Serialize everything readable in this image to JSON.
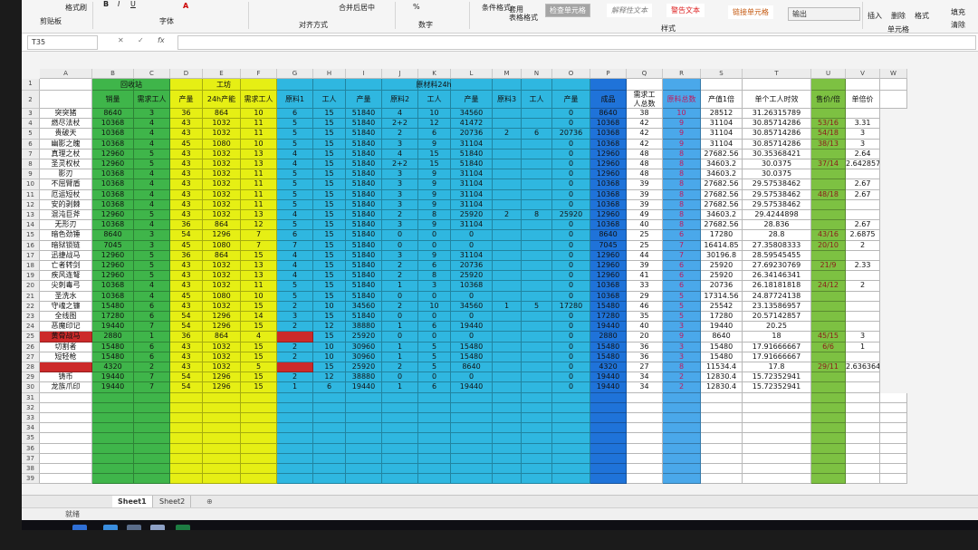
{
  "ribbon": {
    "format_painter": "格式刷",
    "clipboard": "剪贴板",
    "font_group": "字体",
    "align_group": "对齐方式",
    "merge_center": "合并后居中",
    "number_group": "数字",
    "percent": "%",
    "cond_format": "条件格式",
    "table_format": "套用\n表格格式",
    "styles_group": "样式",
    "style_check": "检查单元格",
    "style_explain": "解释性文本",
    "style_warn": "警告文本",
    "style_link": "链接单元格",
    "style_output": "输出",
    "insert": "插入",
    "delete": "删除",
    "format": "格式",
    "cells_group": "单元格",
    "fill": "填充",
    "clear": "清除",
    "bold": "B",
    "italic": "I",
    "underline": "U"
  },
  "formula_bar": {
    "name_box": "T35",
    "cancel": "✕",
    "confirm": "✓",
    "fx": "fx"
  },
  "columns": [
    "A",
    "B",
    "C",
    "D",
    "E",
    "F",
    "G",
    "H",
    "I",
    "J",
    "K",
    "L",
    "M",
    "N",
    "O",
    "P",
    "Q",
    "R",
    "S",
    "T",
    "U",
    "V",
    "W"
  ],
  "header_row1": {
    "A": "",
    "B": "回收站",
    "E": "工坊",
    "G": "原材料24h"
  },
  "header_row2": [
    "",
    "销量",
    "需求工人",
    "产量",
    "24h产能",
    "需求工人",
    "原料1",
    "工人",
    "产量",
    "原料2",
    "工人",
    "产量",
    "原料3",
    "工人",
    "产量",
    "成品",
    "需求工\n人总数",
    "原料总数",
    "产值1倍",
    "单个工人时效",
    "售价/倍",
    "单倍价",
    ""
  ],
  "rows": [
    [
      "突突猪",
      "8640",
      "3",
      "36",
      "864",
      "10",
      "6",
      "15",
      "51840",
      "4",
      "10",
      "34560",
      "",
      "",
      "0",
      "8640",
      "38",
      "10",
      "28512",
      "31.26315789",
      "",
      ""
    ],
    [
      "燃尽法杖",
      "10368",
      "4",
      "43",
      "1032",
      "11",
      "5",
      "15",
      "51840",
      "2+2",
      "12",
      "41472",
      "",
      "",
      "0",
      "10368",
      "42",
      "9",
      "31104",
      "30.85714286",
      "53/16",
      "3.31"
    ],
    [
      "贵破天",
      "10368",
      "4",
      "43",
      "1032",
      "11",
      "5",
      "15",
      "51840",
      "2",
      "6",
      "20736",
      "2",
      "6",
      "20736",
      "10368",
      "42",
      "9",
      "31104",
      "30.85714286",
      "54/18",
      "3"
    ],
    [
      "幽影之魄",
      "10368",
      "4",
      "45",
      "1080",
      "10",
      "5",
      "15",
      "51840",
      "3",
      "9",
      "31104",
      "",
      "",
      "0",
      "10368",
      "42",
      "9",
      "31104",
      "30.85714286",
      "38/13",
      "3"
    ],
    [
      "真理之杖",
      "12960",
      "5",
      "43",
      "1032",
      "13",
      "4",
      "15",
      "51840",
      "4",
      "15",
      "51840",
      "",
      "",
      "0",
      "12960",
      "48",
      "8",
      "27682.56",
      "30.35368421",
      "",
      "2.64"
    ],
    [
      "圣灵权杖",
      "12960",
      "5",
      "43",
      "1032",
      "13",
      "4",
      "15",
      "51840",
      "2+2",
      "15",
      "51840",
      "",
      "",
      "0",
      "12960",
      "48",
      "8",
      "34603.2",
      "30.0375",
      "37/14",
      "2.642857"
    ],
    [
      "影刃",
      "10368",
      "4",
      "43",
      "1032",
      "11",
      "5",
      "15",
      "51840",
      "3",
      "9",
      "31104",
      "",
      "",
      "0",
      "12960",
      "48",
      "8",
      "34603.2",
      "30.0375",
      "",
      ""
    ],
    [
      "不屈臂盾",
      "10368",
      "4",
      "43",
      "1032",
      "11",
      "5",
      "15",
      "51840",
      "3",
      "9",
      "31104",
      "",
      "",
      "0",
      "10368",
      "39",
      "8",
      "27682.56",
      "29.57538462",
      "",
      "2.67"
    ],
    [
      "厄运短杖",
      "10368",
      "4",
      "43",
      "1032",
      "11",
      "5",
      "15",
      "51840",
      "3",
      "9",
      "31104",
      "",
      "",
      "0",
      "10368",
      "39",
      "8",
      "27682.56",
      "29.57538462",
      "48/18",
      "2.67"
    ],
    [
      "安的剥棘",
      "10368",
      "4",
      "43",
      "1032",
      "11",
      "5",
      "15",
      "51840",
      "3",
      "9",
      "31104",
      "",
      "",
      "0",
      "10368",
      "39",
      "8",
      "27682.56",
      "29.57538462",
      "",
      ""
    ],
    [
      "混沌巨斧",
      "12960",
      "5",
      "43",
      "1032",
      "13",
      "4",
      "15",
      "51840",
      "2",
      "8",
      "25920",
      "2",
      "8",
      "25920",
      "12960",
      "49",
      "8",
      "34603.2",
      "29.4244898",
      "",
      ""
    ],
    [
      "无形刃",
      "10368",
      "4",
      "36",
      "864",
      "12",
      "5",
      "15",
      "51840",
      "3",
      "9",
      "31104",
      "",
      "",
      "0",
      "10368",
      "40",
      "8",
      "27682.56",
      "28.836",
      "",
      "2.67"
    ],
    [
      "暗色劲锤",
      "8640",
      "3",
      "54",
      "1296",
      "7",
      "6",
      "15",
      "51840",
      "0",
      "0",
      "0",
      "",
      "",
      "0",
      "8640",
      "25",
      "6",
      "17280",
      "28.8",
      "43/16",
      "2.6875"
    ],
    [
      "暗狱锁链",
      "7045",
      "3",
      "45",
      "1080",
      "7",
      "7",
      "15",
      "51840",
      "0",
      "0",
      "0",
      "",
      "",
      "0",
      "7045",
      "25",
      "7",
      "16414.85",
      "27.35808333",
      "20/10",
      "2"
    ],
    [
      "迅捷战马",
      "12960",
      "5",
      "36",
      "864",
      "15",
      "4",
      "15",
      "51840",
      "3",
      "9",
      "31104",
      "",
      "",
      "0",
      "12960",
      "44",
      "7",
      "30196.8",
      "28.59545455",
      "",
      ""
    ],
    [
      "亡者转剑",
      "12960",
      "5",
      "43",
      "1032",
      "13",
      "4",
      "15",
      "51840",
      "2",
      "6",
      "20736",
      "",
      "",
      "0",
      "12960",
      "39",
      "6",
      "25920",
      "27.69230769",
      "21/9",
      "2.33"
    ],
    [
      "疾风连弩",
      "12960",
      "5",
      "43",
      "1032",
      "13",
      "4",
      "15",
      "51840",
      "2",
      "8",
      "25920",
      "",
      "",
      "0",
      "12960",
      "41",
      "6",
      "25920",
      "26.34146341",
      "",
      ""
    ],
    [
      "尖刺毒弓",
      "10368",
      "4",
      "43",
      "1032",
      "11",
      "5",
      "15",
      "51840",
      "1",
      "3",
      "10368",
      "",
      "",
      "0",
      "10368",
      "33",
      "6",
      "20736",
      "26.18181818",
      "24/12",
      "2"
    ],
    [
      "圣洗水",
      "10368",
      "4",
      "45",
      "1080",
      "10",
      "5",
      "15",
      "51840",
      "0",
      "0",
      "0",
      "",
      "",
      "0",
      "10368",
      "29",
      "5",
      "17314.56",
      "24.87724138",
      "",
      ""
    ],
    [
      "守魂之镰",
      "15480",
      "6",
      "43",
      "1032",
      "15",
      "2",
      "10",
      "34560",
      "2",
      "10",
      "34560",
      "1",
      "5",
      "17280",
      "15480",
      "46",
      "5",
      "25542",
      "23.13586957",
      "",
      ""
    ],
    [
      "全线图",
      "17280",
      "6",
      "54",
      "1296",
      "14",
      "3",
      "15",
      "51840",
      "0",
      "0",
      "0",
      "",
      "",
      "0",
      "17280",
      "35",
      "5",
      "17280",
      "20.57142857",
      "",
      ""
    ],
    [
      "恶魔印记",
      "19440",
      "7",
      "54",
      "1296",
      "15",
      "2",
      "12",
      "38880",
      "1",
      "6",
      "19440",
      "",
      "",
      "0",
      "19440",
      "40",
      "3",
      "19440",
      "20.25",
      "",
      ""
    ],
    [
      "黄骨战马",
      "2880",
      "1",
      "36",
      "864",
      "4",
      "",
      "15",
      "25920",
      "0",
      "0",
      "0",
      "",
      "",
      "0",
      "2880",
      "20",
      "9",
      "8640",
      "18",
      "45/15",
      "3"
    ],
    [
      "切割者",
      "15480",
      "6",
      "43",
      "1032",
      "15",
      "2",
      "10",
      "30960",
      "1",
      "5",
      "15480",
      "",
      "",
      "0",
      "15480",
      "36",
      "3",
      "15480",
      "17.91666667",
      "6/6",
      "1"
    ],
    [
      "短轻枪",
      "15480",
      "6",
      "43",
      "1032",
      "15",
      "2",
      "10",
      "30960",
      "1",
      "5",
      "15480",
      "",
      "",
      "0",
      "15480",
      "36",
      "3",
      "15480",
      "17.91666667",
      "",
      ""
    ],
    [
      "",
      "4320",
      "2",
      "43",
      "1032",
      "5",
      "",
      "15",
      "25920",
      "2",
      "5",
      "8640",
      "",
      "",
      "0",
      "4320",
      "27",
      "8",
      "11534.4",
      "17.8",
      "29/11",
      "2.636364"
    ],
    [
      "铸币",
      "19440",
      "7",
      "54",
      "1296",
      "15",
      "2",
      "12",
      "38880",
      "0",
      "0",
      "0",
      "",
      "",
      "0",
      "19440",
      "34",
      "2",
      "12830.4",
      "15.72352941",
      "",
      ""
    ],
    [
      "龙族爪印",
      "19440",
      "7",
      "54",
      "1296",
      "15",
      "1",
      "6",
      "19440",
      "1",
      "6",
      "19440",
      "",
      "",
      "0",
      "19440",
      "34",
      "2",
      "12830.4",
      "15.72352941",
      "",
      ""
    ]
  ],
  "empty_rows": [
    "31",
    "32",
    "33",
    "34",
    "35",
    "36",
    "37",
    "38",
    "39"
  ],
  "sheets": [
    "Sheet1",
    "Sheet2"
  ],
  "status_text": "就绪",
  "colors": {
    "green": "#3fb54a",
    "yellow": "#e6ef14",
    "cyan": "#2fb7e0",
    "teal": "#2ab9d6",
    "blue": "#1f73d9",
    "lightblue": "#4aa8ea",
    "red": "#cc2a2a",
    "lime": "#7dc142"
  }
}
